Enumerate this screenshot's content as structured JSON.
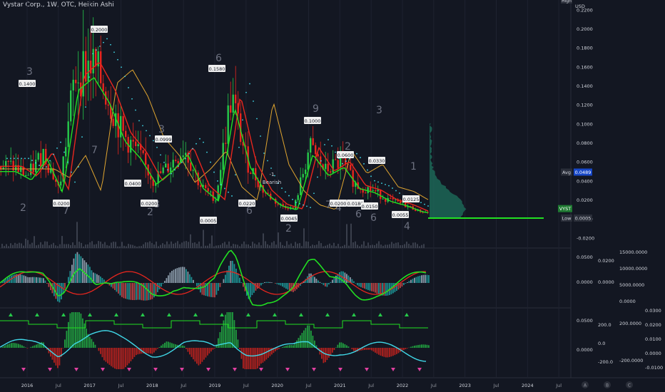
{
  "header": {
    "symbol_info": "Vystar Corp., 1W, OTC, Heikin Ashi"
  },
  "price_axis": {
    "unit_label": "USD",
    "high_tag": "High",
    "ticks": [
      "0.2200",
      "0.2000",
      "0.1800",
      "0.1600",
      "0.1400",
      "0.1200",
      "0.1000",
      "0.0800",
      "0.0600",
      "0.0400",
      "0.0200",
      "0.0000",
      "-0.0200"
    ],
    "avg_label": "Avg",
    "avg_value": "0.0489",
    "symbol_tag": "VYST",
    "low_label": "Low",
    "low_value": "0.0005"
  },
  "time_axis": {
    "ticks": [
      "2016",
      "Jul",
      "2017",
      "Jul",
      "2018",
      "Jul",
      "2019",
      "Jul",
      "2020",
      "Jul",
      "2021",
      "Jul",
      "2022",
      "Jul",
      "2023",
      "Jul",
      "2024",
      "Jul"
    ],
    "circle_buttons": [
      "A",
      "B",
      "C"
    ]
  },
  "chart_annotations": {
    "price_labels": [
      "0.1400",
      "0.0200",
      "0.2000",
      "0.0400",
      "0.0200",
      "0.0999",
      "0.1580",
      "0.0005",
      "0.0220",
      "0.0045",
      "0.1000",
      "0.0200",
      "0.0600",
      "0.0180",
      "0.0150",
      "0.0330",
      "0.0055",
      "0.0125"
    ],
    "wave_counts": [
      "3",
      "2",
      "7",
      "7",
      "8",
      "2",
      "3",
      "6",
      "6",
      "2",
      "9",
      "7",
      "2",
      "3",
      "6",
      "6",
      "4",
      "4",
      "1"
    ],
    "signal_text": "-1",
    "signal_label": "Bearish"
  },
  "pane1_axes": {
    "col1": [
      "0.0500",
      "0.0000"
    ],
    "col2": [
      "0.0200",
      "0.0000"
    ],
    "col3": [
      "15000.0000",
      "10000.0000",
      "5000.0000",
      "0.0000"
    ]
  },
  "pane2_axes": {
    "col1": [
      "0.0500",
      "0.0000"
    ],
    "col2": [
      "200.0",
      "0.0",
      "-200.0"
    ],
    "col3": [
      "200.0000",
      "-200.0000"
    ],
    "col4": [
      "0.0300",
      "0.0200",
      "0.0100",
      "0.0000",
      "-0.0100"
    ]
  },
  "colors": {
    "background": "#131722",
    "up": "#26c94a",
    "down": "#e8261e",
    "teal": "#1fa5a5",
    "orange": "#e0a530",
    "cyan": "#40d8e8",
    "green_line": "#22e022",
    "grid": "#1e2230"
  },
  "chart_data": {
    "type": "candlestick",
    "x": [
      "2016",
      "Jul",
      "2017",
      "Jul",
      "2018",
      "Jul",
      "2019",
      "Jul",
      "2020",
      "Jul",
      "2021",
      "Jul",
      "2022",
      "Jul",
      "2023",
      "Jul",
      "2024",
      "Jul"
    ],
    "series": [
      {
        "x": [
          "2015-10",
          "2016-01",
          "2016-04",
          "2016-07",
          "2016-10",
          "2017-01",
          "2017-04",
          "2017-07",
          "2017-10",
          "2018-01",
          "2018-04",
          "2018-07",
          "2018-10",
          "2019-01",
          "2019-04",
          "2019-07",
          "2019-10",
          "2020-01",
          "2020-04",
          "2020-07",
          "2020-10",
          "2021-01",
          "2021-04",
          "2021-07",
          "2021-10",
          "2022-01",
          "2022-04",
          "2022-06"
        ],
        "values": [
          0.055,
          0.045,
          0.07,
          0.03,
          0.15,
          0.165,
          0.135,
          0.09,
          0.07,
          0.04,
          0.055,
          0.075,
          0.035,
          0.02,
          0.13,
          0.06,
          0.03,
          0.015,
          0.01,
          0.075,
          0.05,
          0.06,
          0.035,
          0.03,
          0.02,
          0.015,
          0.008,
          0.006
        ]
      }
    ],
    "ylim": [
      -0.025,
      0.23
    ],
    "volume_profile": "right",
    "avg": 0.0489,
    "low": 0.0005
  }
}
